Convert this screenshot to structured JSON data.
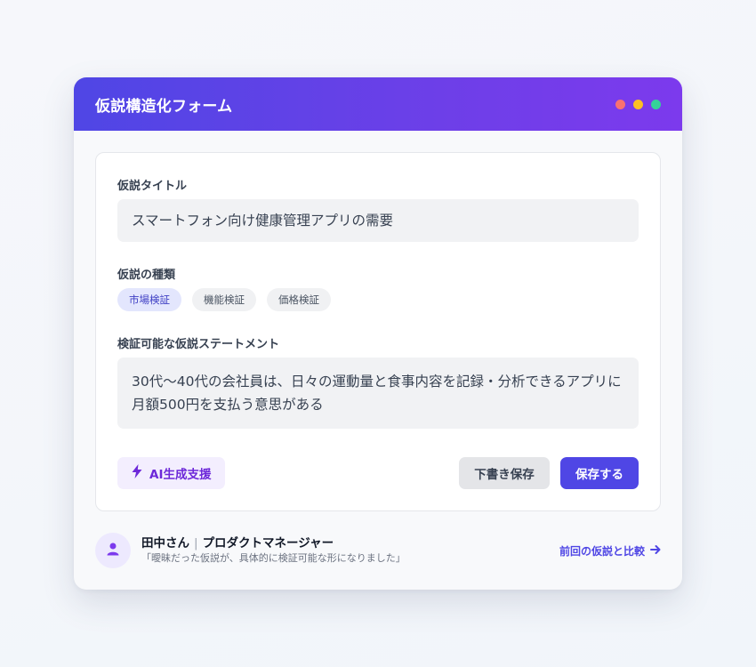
{
  "window": {
    "title": "仮説構造化フォーム",
    "controls": [
      {
        "name": "red",
        "color": "#f87171"
      },
      {
        "name": "yellow",
        "color": "#fbbf24"
      },
      {
        "name": "green",
        "color": "#34d399"
      }
    ]
  },
  "form": {
    "title_label": "仮説タイトル",
    "title_value": "スマートフォン向け健康管理アプリの需要",
    "type_label": "仮説の種類",
    "types": [
      {
        "label": "市場検証",
        "selected": true
      },
      {
        "label": "機能検証",
        "selected": false
      },
      {
        "label": "価格検証",
        "selected": false
      }
    ],
    "statement_label": "検証可能な仮説ステートメント",
    "statement_value": "30代〜40代の会社員は、日々の運動量と食事内容を記録・分析できるアプリに月額500円を支払う意思がある"
  },
  "actions": {
    "ai_label": "AI生成支援",
    "ai_icon": "lightning-icon",
    "draft_label": "下書き保存",
    "save_label": "保存する"
  },
  "footer": {
    "user_name": "田中さん",
    "separator": "|",
    "user_role": "プロダクトマネージャー",
    "quote": "「曖昧だった仮説が、具体的に検証可能な形になりました」",
    "compare_label": "前回の仮説と比較",
    "avatar_icon": "user-icon",
    "compare_icon": "arrow-right-icon"
  },
  "colors": {
    "accent": "#4f46e5",
    "header_gradient_end": "#7c3aed",
    "ai_text": "#6d28d9"
  }
}
